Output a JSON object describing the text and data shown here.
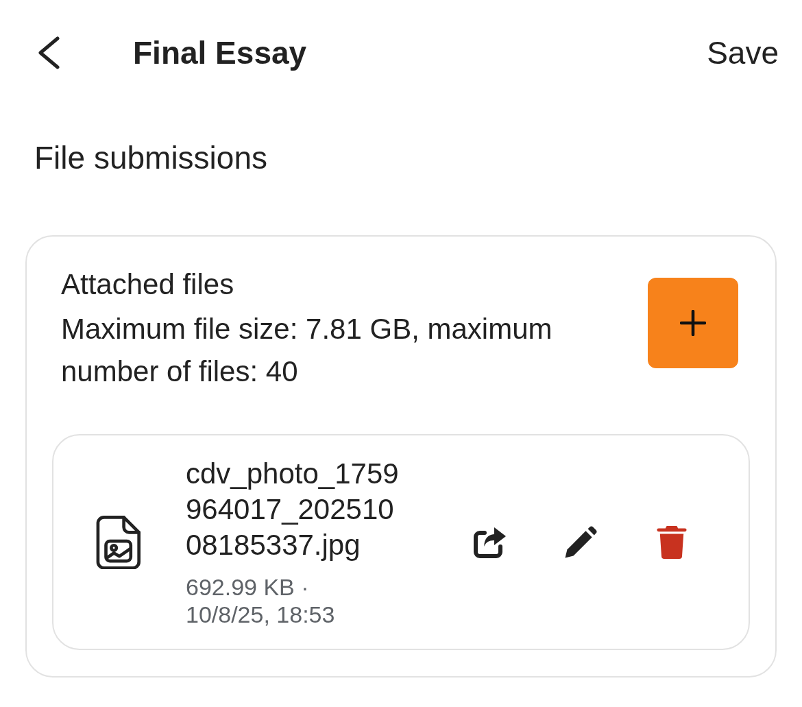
{
  "header": {
    "title": "Final Essay",
    "action": "Save"
  },
  "section_title": "File submissions",
  "attachments": {
    "title": "Attached files",
    "description": "Maximum file size: 7.81 GB, maximum number of files: 40",
    "files": [
      {
        "name": "cdv_photo_1759964017_20251008185337.jpg",
        "meta": "692.99 KB · 10/8/25, 18:53"
      }
    ]
  }
}
